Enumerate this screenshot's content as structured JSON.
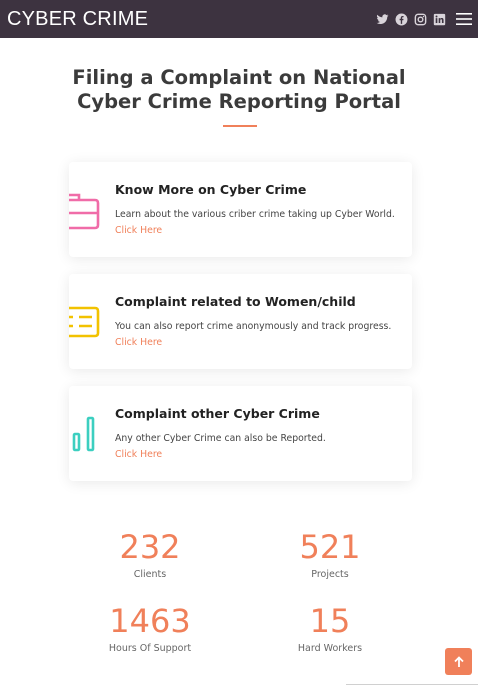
{
  "brand": "CYBER CRIME",
  "social": [
    "twitter-icon",
    "facebook-icon",
    "instagram-icon",
    "linkedin-icon"
  ],
  "title_line1": "Filing a Complaint on National",
  "title_line2": "Cyber Crime Reporting Portal",
  "accent": "#f0805a",
  "cards": [
    {
      "heading": "Know More on Cyber Crime",
      "text": "Learn about the various criber crime taking up Cyber World.",
      "link": "Click Here",
      "icon": "briefcase-icon",
      "icon_color": "#f06ca8"
    },
    {
      "heading": "Complaint related to Women/child",
      "text": "You can also report crime anonymously and track progress.",
      "link": "Click Here",
      "icon": "card-text-icon",
      "icon_color": "#f2c200"
    },
    {
      "heading": "Complaint other Cyber Crime",
      "text": "Any other Cyber Crime can also be Reported.",
      "link": "Click Here",
      "icon": "bar-chart-icon",
      "icon_color": "#3ccfc0"
    }
  ],
  "stats": [
    {
      "value": "232",
      "label": "Clients"
    },
    {
      "value": "521",
      "label": "Projects"
    },
    {
      "value": "1463",
      "label": "Hours Of Support"
    },
    {
      "value": "15",
      "label": "Hard Workers"
    }
  ]
}
